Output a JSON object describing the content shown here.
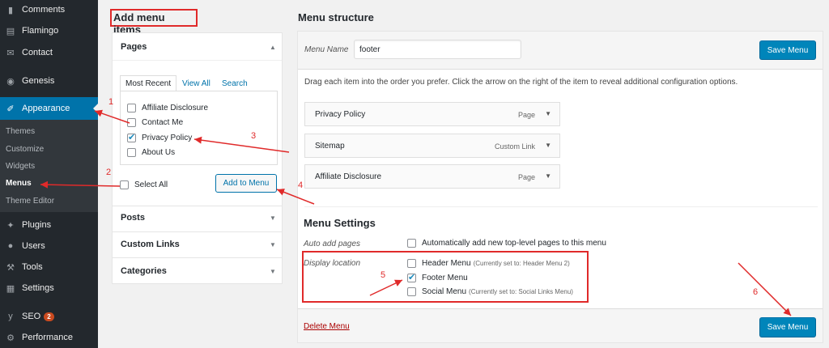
{
  "sidebar": {
    "items": [
      {
        "label": "Comments",
        "icon": "comment-icon"
      },
      {
        "label": "Flamingo",
        "icon": "flamingo-icon"
      },
      {
        "label": "Contact",
        "icon": "mail-icon"
      },
      {
        "label": "Genesis",
        "icon": "genesis-icon"
      },
      {
        "label": "Appearance",
        "icon": "paintbrush-icon"
      },
      {
        "label": "Plugins",
        "icon": "plugin-icon"
      },
      {
        "label": "Users",
        "icon": "users-icon"
      },
      {
        "label": "Tools",
        "icon": "wrench-icon"
      },
      {
        "label": "Settings",
        "icon": "settings-icon"
      },
      {
        "label": "SEO",
        "icon": "yoast-icon",
        "badge": "2"
      },
      {
        "label": "Performance",
        "icon": "performance-icon"
      }
    ],
    "submenu": [
      "Themes",
      "Customize",
      "Widgets",
      "Menus",
      "Theme Editor"
    ]
  },
  "left": {
    "heading": "Add menu items",
    "pages": {
      "title": "Pages",
      "tabs": [
        "Most Recent",
        "View All",
        "Search"
      ],
      "items": [
        {
          "label": "Affiliate Disclosure",
          "checked": false
        },
        {
          "label": "Contact Me",
          "checked": false
        },
        {
          "label": "Privacy Policy",
          "checked": true
        },
        {
          "label": "About Us",
          "checked": false
        }
      ],
      "select_all": "Select All",
      "add_button": "Add to Menu"
    },
    "sections": [
      "Posts",
      "Custom Links",
      "Categories"
    ]
  },
  "right": {
    "heading": "Menu structure",
    "menu_name_label": "Menu Name",
    "menu_name_value": "footer",
    "save_label": "Save Menu",
    "instructions": "Drag each item into the order you prefer. Click the arrow on the right of the item to reveal additional configuration options.",
    "items": [
      {
        "title": "Privacy Policy",
        "type": "Page"
      },
      {
        "title": "Sitemap",
        "type": "Custom Link"
      },
      {
        "title": "Affiliate Disclosure",
        "type": "Page"
      }
    ],
    "settings_heading": "Menu Settings",
    "auto_add_label": "Auto add pages",
    "auto_add_text": "Automatically add new top-level pages to this menu",
    "display_location_label": "Display location",
    "locations": [
      {
        "label": "Header Menu",
        "note": "(Currently set to: Header Menu 2)",
        "checked": false
      },
      {
        "label": "Footer Menu",
        "note": "",
        "checked": true
      },
      {
        "label": "Social Menu",
        "note": "(Currently set to: Social Links Menu)",
        "checked": false
      }
    ],
    "delete_label": "Delete Menu"
  },
  "annotations": [
    "1",
    "2",
    "3",
    "4",
    "5",
    "6"
  ],
  "colors": {
    "sidebar_bg": "#23282d",
    "active_bg": "#0073aa",
    "primary_button": "#0085ba",
    "annotation_red": "#e02a2a",
    "delete_link": "#a00"
  }
}
